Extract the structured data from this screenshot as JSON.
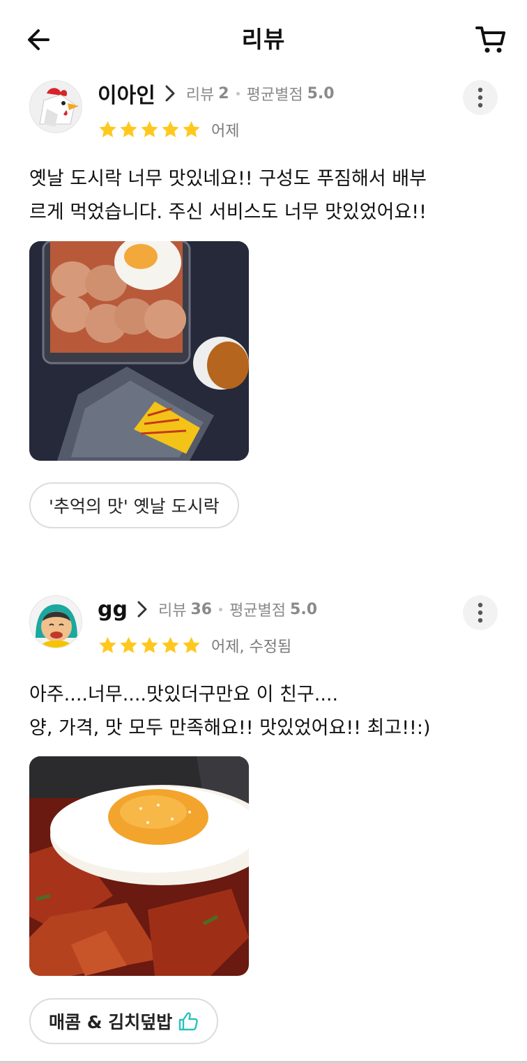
{
  "header": {
    "title": "리뷰",
    "back_icon": "arrow-left-icon",
    "cart_icon": "cart-icon"
  },
  "colors": {
    "star": "#FFC81E",
    "chip_border": "#dcdcdc",
    "like_icon": "#2AC1BC"
  },
  "reviews": [
    {
      "nickname": "이아인",
      "review_label": "리뷰",
      "review_count": "2",
      "avg_label": "평균별점",
      "avg_score": "5.0",
      "rating": 5,
      "date": "어제",
      "text": "옛날 도시락 너무 맛있네요!! 구성도 푸짐해서 배부\n르게 먹었습니다. 주신 서비스도 너무 맛있었어요!!",
      "menu": "'추억의 맛' 옛날 도시락"
    },
    {
      "nickname": "gg",
      "review_label": "리뷰",
      "review_count": "36",
      "avg_label": "평균별점",
      "avg_score": "5.0",
      "rating": 5,
      "date": "어제, 수정됨",
      "text": "아주....너무....맛있더구만요 이 친구....\n양, 가격, 맛 모두 만족해요!! 맛있었어요!! 최고!!:)",
      "menu": "매콤 & 김치덮밥"
    }
  ]
}
